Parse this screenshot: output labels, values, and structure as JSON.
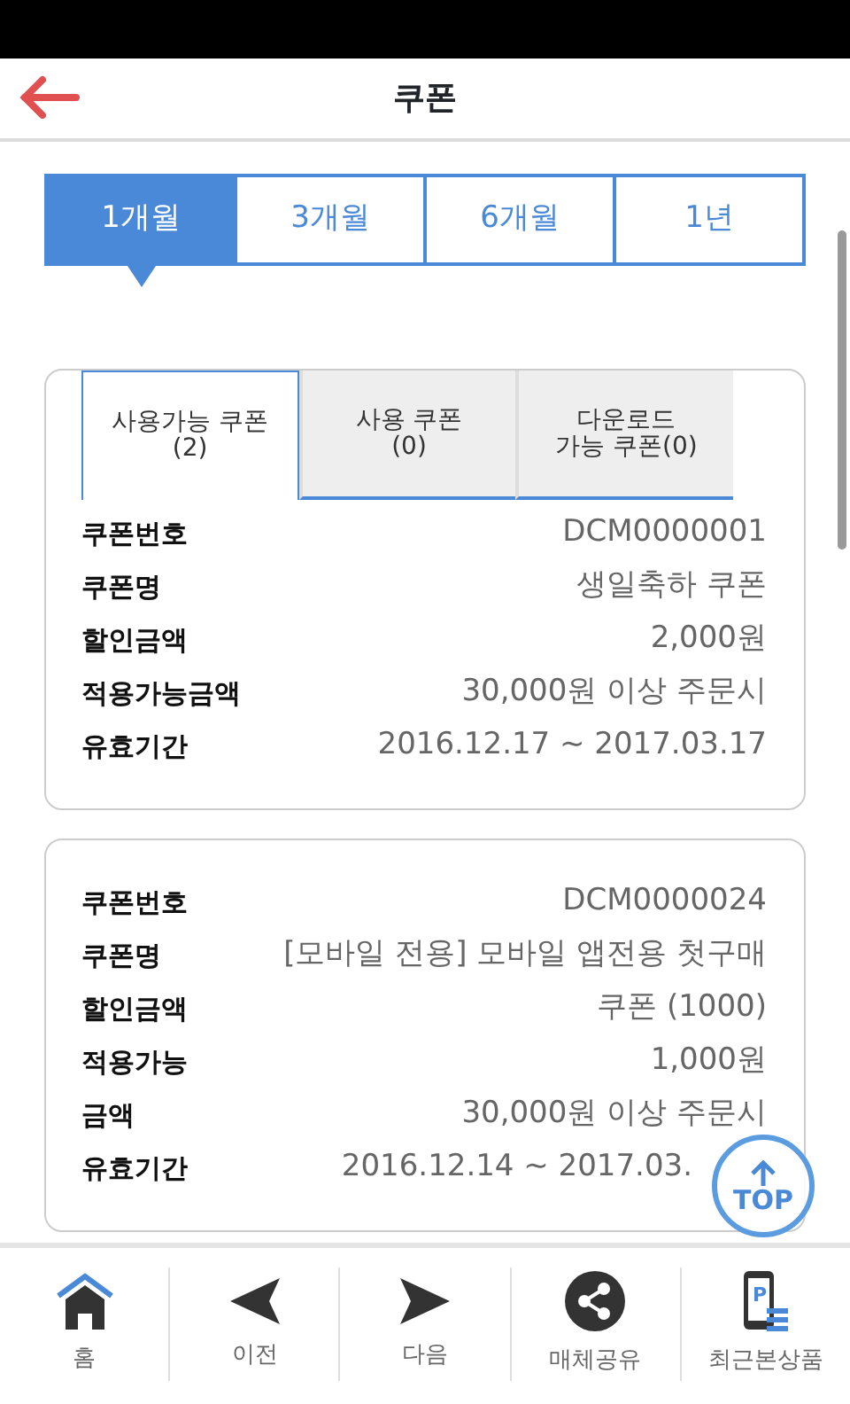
{
  "header": {
    "title": "쿠폰"
  },
  "period_tabs": [
    {
      "label": "1개월",
      "selected": true
    },
    {
      "label": "3개월",
      "selected": false
    },
    {
      "label": "6개월",
      "selected": false
    },
    {
      "label": "1년",
      "selected": false
    }
  ],
  "coupon_tabs": [
    {
      "lines": [
        "사용가능 쿠폰",
        "(2)"
      ],
      "selected": true
    },
    {
      "lines": [
        "사용 쿠폰",
        "(0)"
      ],
      "selected": false
    },
    {
      "lines": [
        "다운로드",
        "가능 쿠폰(0)"
      ],
      "selected": false
    }
  ],
  "coupons": [
    {
      "rows": [
        {
          "label": "쿠폰번호",
          "value": "DCM0000001"
        },
        {
          "label": "쿠폰명",
          "value": "생일축하 쿠폰"
        },
        {
          "label": "할인금액",
          "value": "2,000원"
        },
        {
          "label": "적용가능금액",
          "value": "30,000원 이상 주문시"
        },
        {
          "label": "유효기간",
          "value": "2016.12.17 ~ 2017.03.17"
        }
      ]
    },
    {
      "rows": [
        {
          "label": "쿠폰번호",
          "value": "DCM0000024"
        },
        {
          "label": "쿠폰명",
          "value": "[모바일 전용] 모바일 앱전용 첫구매"
        },
        {
          "label": "할인금액",
          "value": "쿠폰 (1000)"
        },
        {
          "label": "적용가능",
          "value": "1,000원"
        },
        {
          "label": "금액",
          "value": "30,000원 이상 주문시"
        },
        {
          "label": "유효기간",
          "value": "2016.12.14 ~ 2017.03."
        }
      ]
    }
  ],
  "top_button": {
    "label": "TOP"
  },
  "bottom_nav": [
    {
      "kind": "home",
      "label": "홈"
    },
    {
      "kind": "prev",
      "label": "이전"
    },
    {
      "kind": "next",
      "label": "다음"
    },
    {
      "kind": "share",
      "label": "매체공유"
    },
    {
      "kind": "recent",
      "label": "최근본상품",
      "icon_letter": "P"
    }
  ]
}
